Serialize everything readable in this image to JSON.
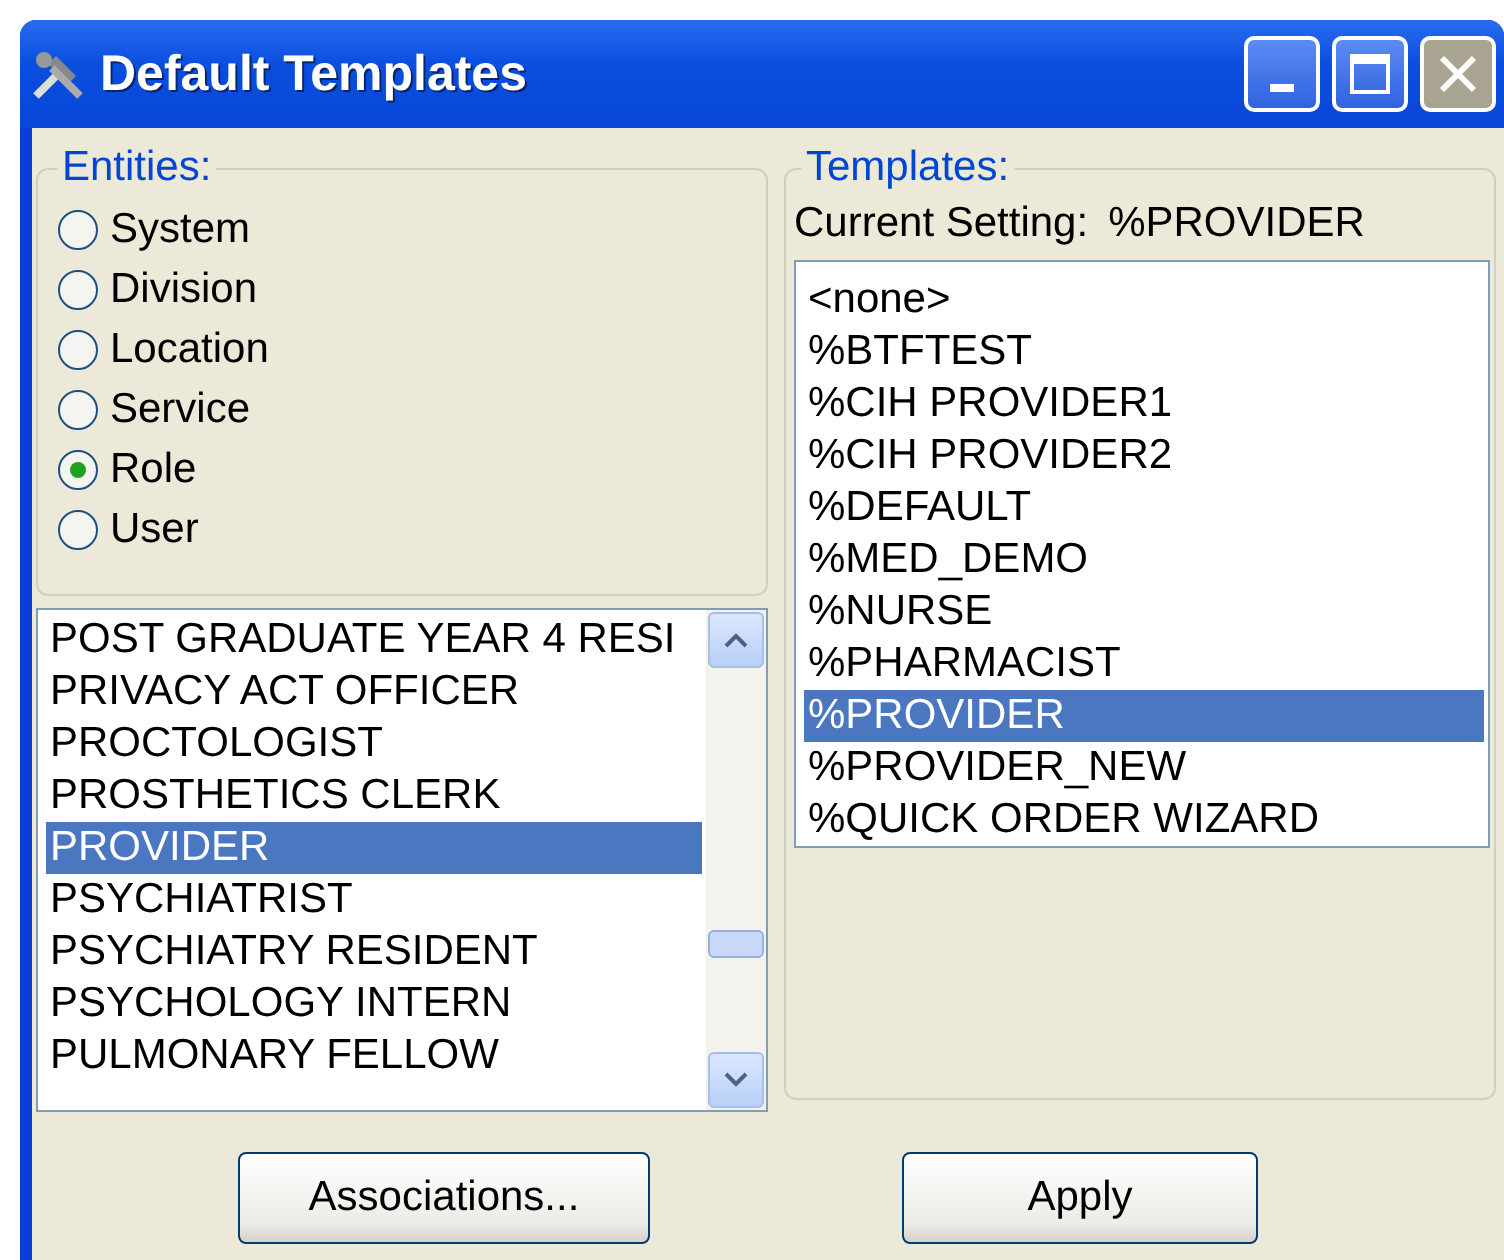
{
  "window": {
    "title": "Default Templates"
  },
  "entities": {
    "legend": "Entities:",
    "options": [
      {
        "label": "System",
        "selected": false
      },
      {
        "label": "Division",
        "selected": false
      },
      {
        "label": "Location",
        "selected": false
      },
      {
        "label": "Service",
        "selected": false
      },
      {
        "label": "Role",
        "selected": true
      },
      {
        "label": "User",
        "selected": false
      }
    ]
  },
  "entity_list": {
    "items": [
      {
        "label": "POST GRADUATE YEAR 4 RESI",
        "selected": false
      },
      {
        "label": "PRIVACY ACT OFFICER",
        "selected": false
      },
      {
        "label": "PROCTOLOGIST",
        "selected": false
      },
      {
        "label": "PROSTHETICS CLERK",
        "selected": false
      },
      {
        "label": "PROVIDER",
        "selected": true
      },
      {
        "label": "PSYCHIATRIST",
        "selected": false
      },
      {
        "label": "PSYCHIATRY RESIDENT",
        "selected": false
      },
      {
        "label": "PSYCHOLOGY INTERN",
        "selected": false
      },
      {
        "label": "PULMONARY FELLOW",
        "selected": false
      }
    ]
  },
  "templates": {
    "legend": "Templates:",
    "current_label": "Current Setting:",
    "current_value": "%PROVIDER",
    "items": [
      {
        "label": "<none>",
        "selected": false
      },
      {
        "label": "%BTFTEST",
        "selected": false
      },
      {
        "label": "%CIH PROVIDER1",
        "selected": false
      },
      {
        "label": "%CIH PROVIDER2",
        "selected": false
      },
      {
        "label": "%DEFAULT",
        "selected": false
      },
      {
        "label": "%MED_DEMO",
        "selected": false
      },
      {
        "label": "%NURSE",
        "selected": false
      },
      {
        "label": "%PHARMACIST",
        "selected": false
      },
      {
        "label": "%PROVIDER",
        "selected": true
      },
      {
        "label": "%PROVIDER_NEW",
        "selected": false
      },
      {
        "label": "%QUICK ORDER WIZARD",
        "selected": false
      }
    ]
  },
  "buttons": [
    {
      "label": "Associations..."
    },
    {
      "label": "Apply"
    }
  ]
}
